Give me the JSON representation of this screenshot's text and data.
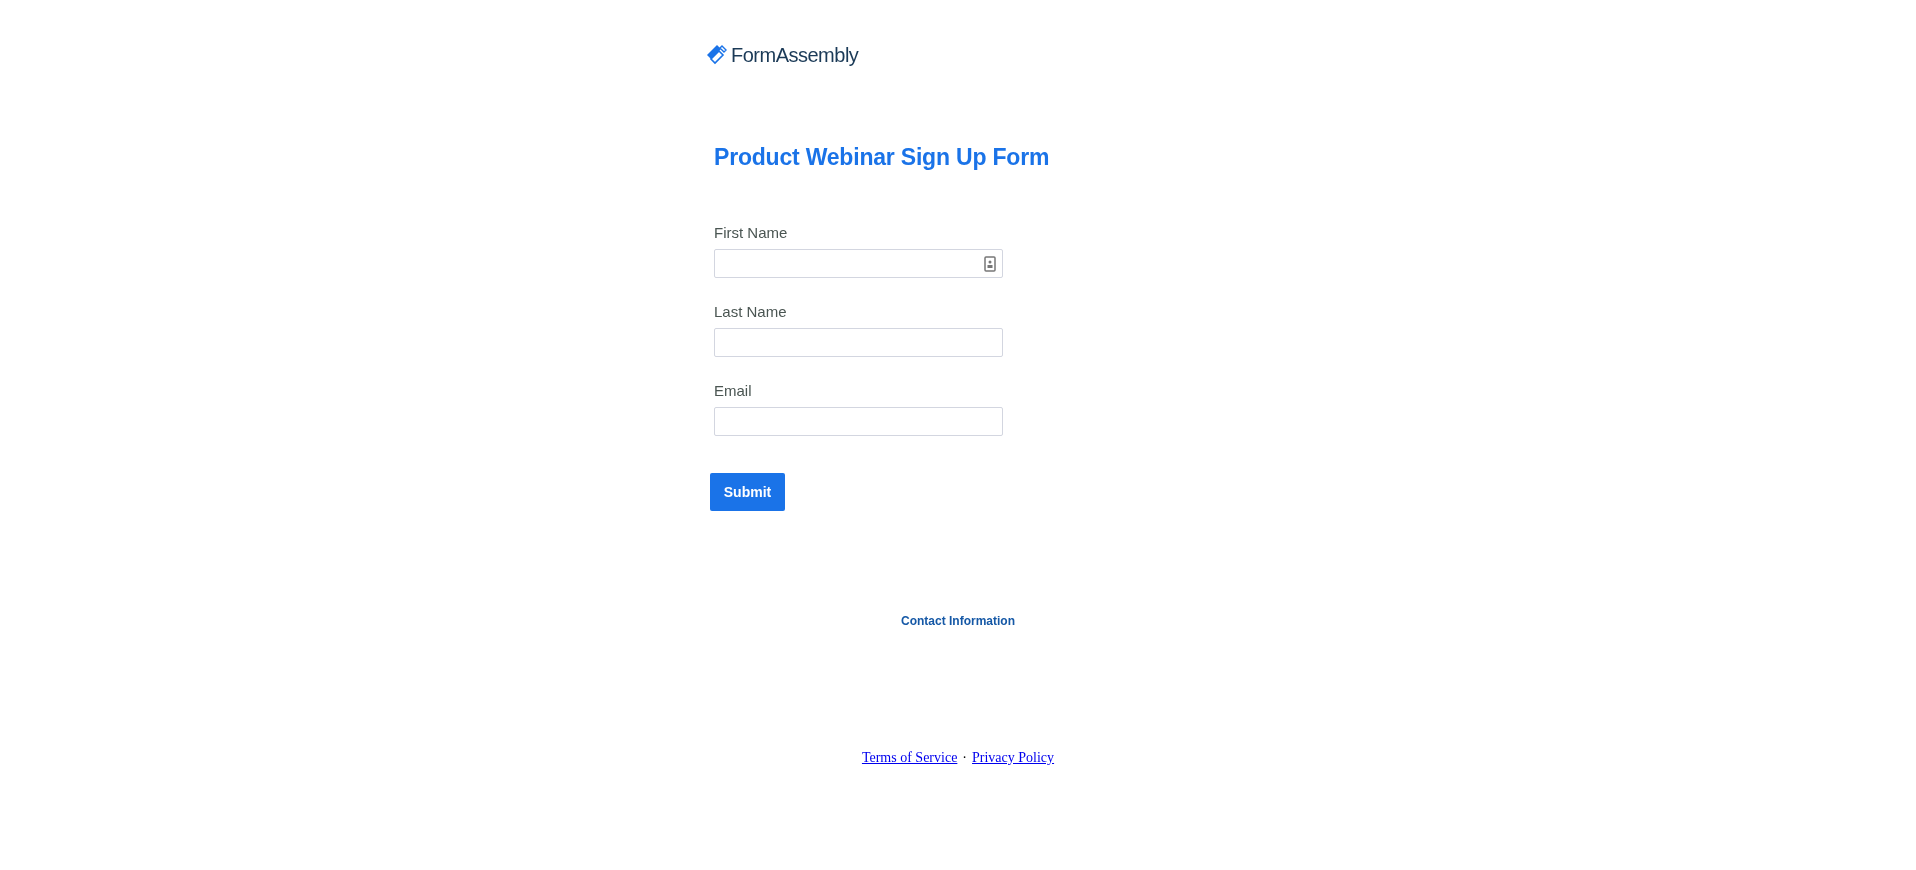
{
  "logo": {
    "text": "FormAssembly"
  },
  "form": {
    "title": "Product Webinar Sign Up Form",
    "fields": [
      {
        "label": "First Name",
        "autofill_icon": true
      },
      {
        "label": "Last Name",
        "autofill_icon": false
      },
      {
        "label": "Email",
        "autofill_icon": false
      }
    ],
    "submit": "Submit"
  },
  "contact": "Contact Information",
  "footer": {
    "links": [
      "Terms of Service",
      "Privacy Policy"
    ],
    "separator": "·"
  }
}
